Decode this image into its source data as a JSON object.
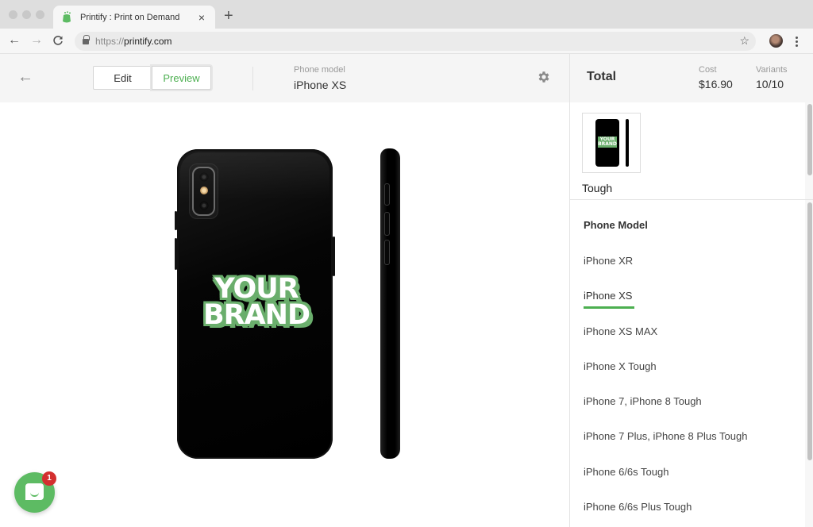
{
  "browser": {
    "tab_title": "Printify : Print on Demand",
    "url_scheme": "https://",
    "url_host": "printify.com",
    "new_tab_label": "+",
    "close_tab_label": "×"
  },
  "editor": {
    "back_label": "←",
    "mode_buttons": {
      "edit": "Edit",
      "preview": "Preview",
      "active": "Preview"
    },
    "phone_model_label": "Phone model",
    "phone_model_value": "iPhone XS",
    "design_text": [
      "YOUR",
      "BRAND"
    ],
    "accent_color": "#4caf50"
  },
  "chat": {
    "badge_count": "1"
  },
  "summary": {
    "total_label": "Total",
    "cost_label": "Cost",
    "cost_value": "$16.90",
    "variants_label": "Variants",
    "variants_value": "10/10"
  },
  "variant": {
    "name": "Tough",
    "thumb_text": "YOUR BRAND"
  },
  "model_list": {
    "heading": "Phone Model",
    "selected": "iPhone XS",
    "items": [
      "iPhone XR",
      "iPhone XS",
      "iPhone XS MAX",
      "iPhone X Tough",
      "iPhone 7, iPhone 8 Tough",
      "iPhone 7 Plus, iPhone 8 Plus Tough",
      "iPhone 6/6s Tough",
      "iPhone 6/6s Plus Tough"
    ]
  }
}
